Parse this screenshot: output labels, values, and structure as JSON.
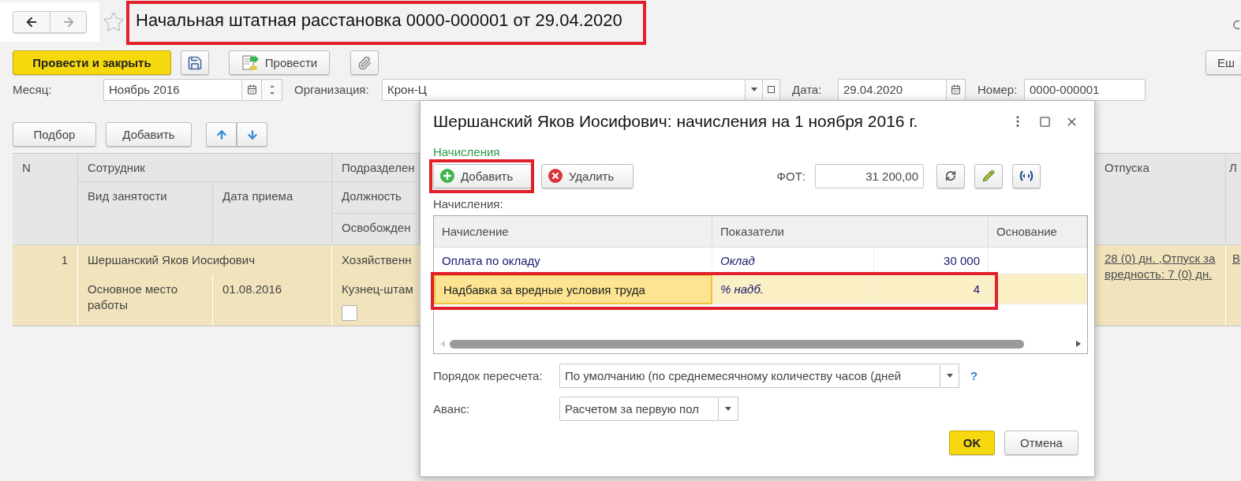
{
  "nav": {
    "back_enabled": true,
    "forward_enabled": false
  },
  "favorite": false,
  "title": {
    "text": "Начальная штатная расстановка 0000-000001 от 29.04.2020",
    "highlighted": true
  },
  "toolbar": {
    "post_close": "Провести и закрыть",
    "post": "Провести",
    "more": "Еш"
  },
  "fields": [
    {
      "label": "Месяц:",
      "value": "Ноябрь 2016",
      "kind": "month"
    },
    {
      "label": "Организация:",
      "value": "Крон-Ц",
      "kind": "select"
    },
    {
      "label": "Дата:",
      "value": "29.04.2020",
      "kind": "date"
    },
    {
      "label": "Номер:",
      "value": "0000-000001",
      "kind": "text"
    }
  ],
  "list_buttons": [
    "Подбор",
    "Добавить"
  ],
  "table": {
    "headers": {
      "number": "N",
      "employee": "Сотрудник",
      "employment_type": "Вид занятости",
      "hire_date": "Дата приема",
      "department": "Подразделен",
      "position": "Должность",
      "released": "Освобожден",
      "vacations": "Отпуска",
      "column_7": "Л"
    },
    "rows": [
      {
        "number": "1",
        "employee": "Шершанский Яков Иосифович",
        "employment_type": "Основное место работы",
        "hire_date": "01.08.2016",
        "department": "Хозяйственн",
        "position": "Кузнец-штам",
        "released": false,
        "vacations": "28 (0) дн. ,Отпуск за вредность: 7 (0) дн.",
        "column_7": "В",
        "selected": true
      }
    ]
  },
  "dialog": {
    "title": "Шершанский Яков Иосифович: начисления на 1 ноября 2016 г.",
    "group_label": "Начисления",
    "add_button": {
      "label": "Добавить",
      "highlighted": true
    },
    "delete_button": "Удалить",
    "fot": {
      "label": "ФОТ:",
      "value": "31 200,00"
    },
    "table_label": "Начисления:",
    "columns": [
      "Начисление",
      "Показатели",
      "Основание"
    ],
    "rows": [
      {
        "accrual": "Оплата по окладу",
        "indicator": "Оклад",
        "value": "30 000",
        "selected": false,
        "highlighted": false
      },
      {
        "accrual": "Надбавка за вредные условия труда",
        "indicator": "% надб.",
        "value": "4",
        "selected": true,
        "highlighted": true
      }
    ],
    "recalc": {
      "label": "Порядок пересчета:",
      "value": "По умолчанию (по среднемесячному количеству часов (дней",
      "help": "?"
    },
    "advance": {
      "label": "Аванс:",
      "value": "Расчетом за первую пол"
    },
    "ok": "OK",
    "cancel": "Отмена"
  }
}
